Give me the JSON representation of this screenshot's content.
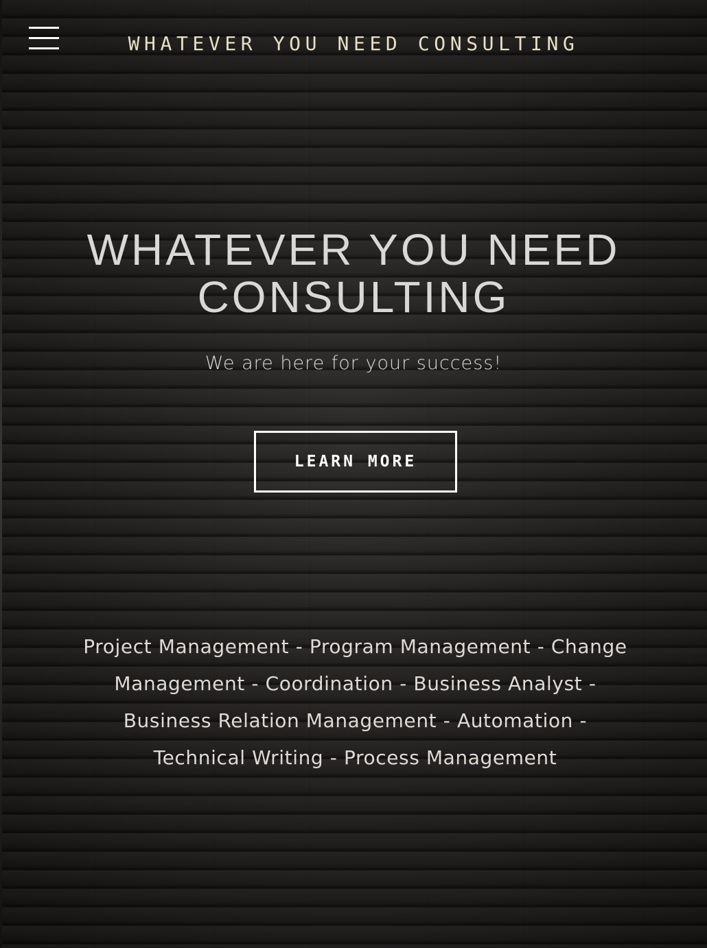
{
  "header": {
    "site_title": "WHATEVER YOU NEED CONSULTING",
    "menu_icon": "hamburger-menu-icon"
  },
  "hero": {
    "title_line1": "WHATEVER YOU NEED",
    "title_line2": "CONSULTING",
    "tagline": "We are here for your success!",
    "cta_label": "LEARN MORE"
  },
  "services": {
    "text": "Project Management - Program Management - Change Management - Coordination - Business Analyst - Business Relation Management - Automation - Technical Writing - Process Management"
  },
  "colors": {
    "background": "#1f1d1c",
    "site_title": "#e9dfc6",
    "hero_title": "#d8d8d8",
    "button_border": "#ffffff"
  }
}
